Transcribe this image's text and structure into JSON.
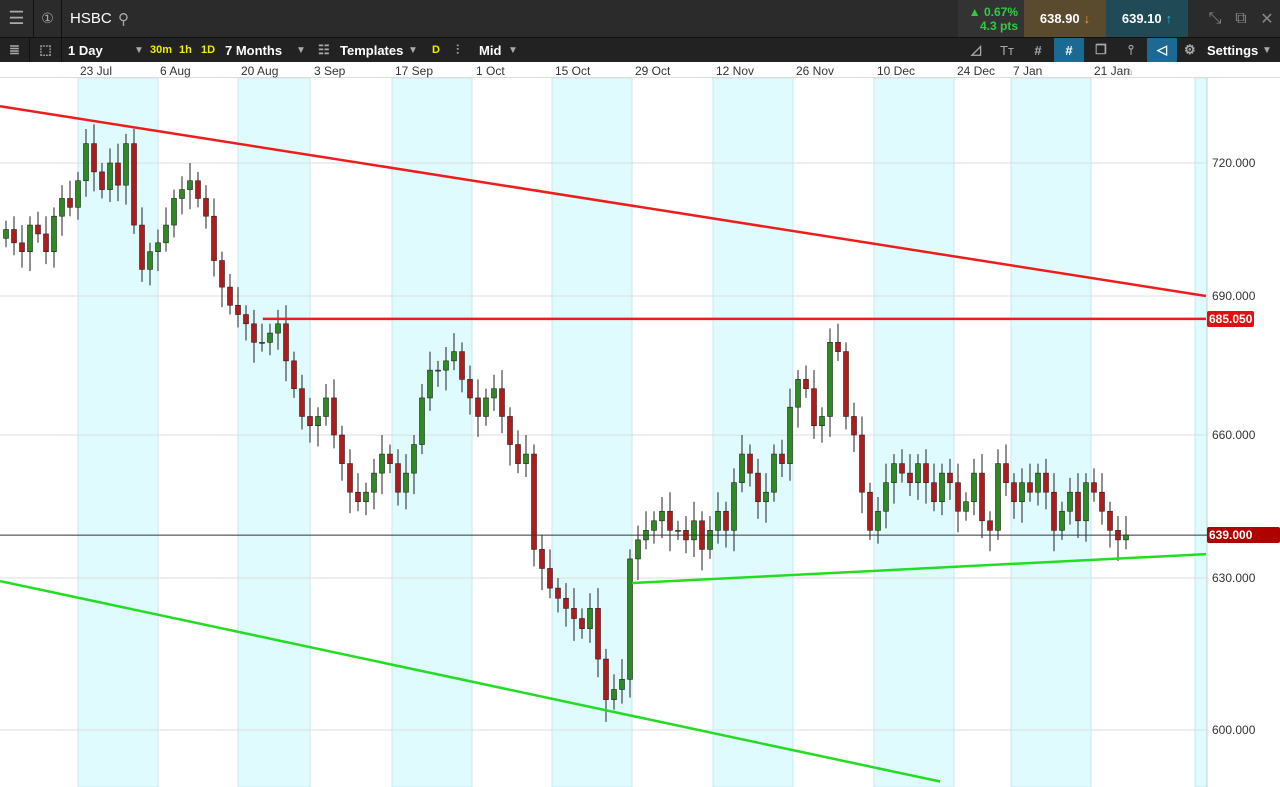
{
  "header": {
    "symbol": "HSBC",
    "change_pct": "▲ 0.67%",
    "change_pts": "4.3 pts",
    "sell": "638.90",
    "buy": "639.10"
  },
  "toolbar": {
    "interval": "1 Day",
    "q1": "30m",
    "q2": "1h",
    "q3": "1D",
    "range": "7 Months",
    "templates": "Templates",
    "d": "D",
    "price_type": "Mid",
    "settings": "Settings"
  },
  "dates": [
    "23 Jul",
    "6 Aug",
    "20 Aug",
    "3 Sep",
    "17 Sep",
    "1 Oct",
    "15 Oct",
    "29 Oct",
    "12 Nov",
    "26 Nov",
    "10 Dec",
    "24 Dec",
    "7 Jan",
    "21 Jan"
  ],
  "colors": {
    "up": "#2e8b22",
    "down": "#b01c1c",
    "resistance": "#ee1c1c",
    "support": "#22dd22"
  },
  "chart_data": {
    "type": "candlestick",
    "y_ticks": [
      "720.000",
      "690.000",
      "660.000",
      "630.000",
      "600.000"
    ],
    "y_tick_values": [
      720,
      690,
      660,
      630,
      600
    ],
    "current_price": "639.000",
    "current_value": 639,
    "level_label": "685.050",
    "level_value": 685.05,
    "closes": [
      705,
      702,
      700,
      706,
      704,
      700,
      708,
      712,
      710,
      716,
      724,
      718,
      714,
      720,
      715,
      724,
      706,
      696,
      700,
      702,
      706,
      712,
      714,
      716,
      712,
      708,
      698,
      692,
      688,
      686,
      684,
      680,
      680,
      682,
      684,
      676,
      670,
      664,
      662,
      664,
      668,
      660,
      654,
      648,
      646,
      648,
      652,
      656,
      654,
      648,
      652,
      658,
      668,
      674,
      674,
      676,
      678,
      672,
      668,
      664,
      668,
      670,
      664,
      658,
      654,
      656,
      636,
      632,
      628,
      626,
      624,
      622,
      620,
      624,
      614,
      606,
      608,
      610,
      634,
      638,
      640,
      642,
      644,
      640,
      640,
      638,
      642,
      636,
      640,
      644,
      640,
      650,
      656,
      652,
      646,
      648,
      656,
      654,
      666,
      672,
      670,
      662,
      664,
      680,
      678,
      664,
      660,
      648,
      640,
      644,
      650,
      654,
      652,
      650,
      654,
      650,
      646,
      652,
      650,
      644,
      646,
      652,
      642,
      640,
      654,
      650,
      646,
      650,
      648,
      652,
      648,
      640,
      644,
      648,
      642,
      650,
      648,
      644,
      640,
      638,
      639
    ],
    "trendlines": [
      {
        "name": "upper-resistance",
        "color": "red",
        "points": [
          [
            -0.75,
            731.7
          ],
          [
            150,
            690
          ]
        ]
      },
      {
        "name": "horizontal-resistance",
        "color": "red",
        "points": [
          [
            32.1,
            685.05
          ],
          [
            150,
            685.05
          ]
        ]
      },
      {
        "name": "lower-support",
        "color": "green",
        "points": [
          [
            78.25,
            629
          ],
          [
            150,
            635
          ]
        ]
      },
      {
        "name": "channel-support",
        "color": "green",
        "points": [
          [
            -0.75,
            629.4
          ],
          [
            116.75,
            589.7
          ]
        ]
      }
    ]
  }
}
